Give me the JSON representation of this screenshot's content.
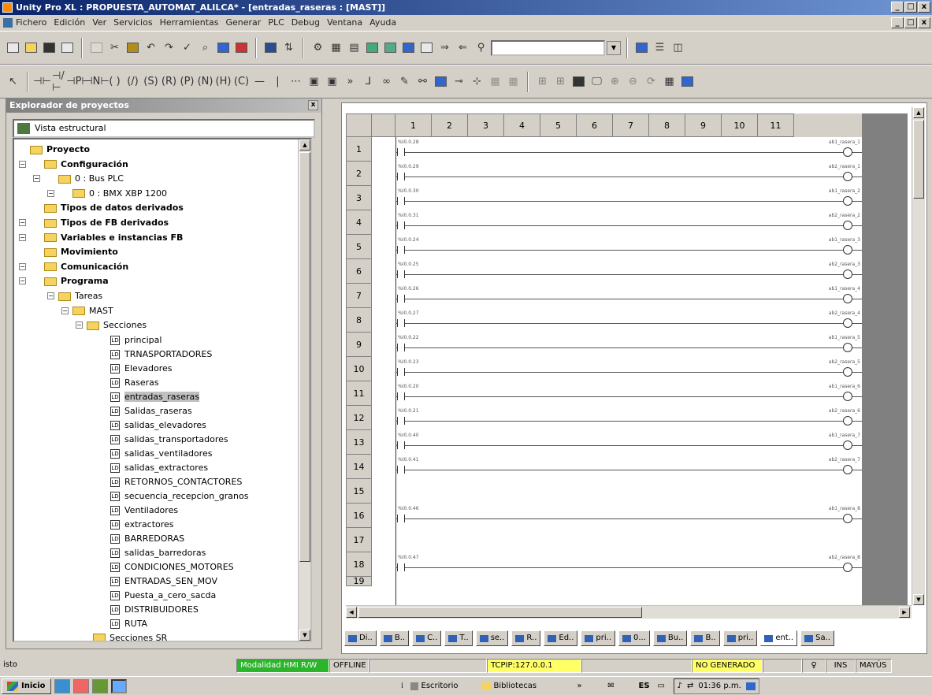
{
  "window": {
    "title": "Unity Pro XL : PROPUESTA_AUTOMAT_ALILCA* - [entradas_raseras : [MAST]]",
    "min": "_",
    "max": "□",
    "close": "x"
  },
  "menu": [
    "Fichero",
    "Edición",
    "Ver",
    "Servicios",
    "Herramientas",
    "Generar",
    "PLC",
    "Debug",
    "Ventana",
    "Ayuda"
  ],
  "explorer": {
    "title": "Explorador de proyectos",
    "view": "Vista estructural",
    "tree": [
      {
        "label": "Proyecto",
        "bold": true
      },
      {
        "label": "Configuración",
        "bold": true
      },
      {
        "label": "0 : Bus PLC",
        "bold": false
      },
      {
        "label": "0 : BMX XBP 1200",
        "bold": false
      },
      {
        "label": "Tipos de datos derivados",
        "bold": true
      },
      {
        "label": "Tipos de FB derivados",
        "bold": true
      },
      {
        "label": "Variables e instancias FB",
        "bold": true
      },
      {
        "label": "Movimiento",
        "bold": true
      },
      {
        "label": "Comunicación",
        "bold": true
      },
      {
        "label": "Programa",
        "bold": true
      },
      {
        "label": "Tareas",
        "bold": false
      },
      {
        "label": "MAST",
        "bold": false
      },
      {
        "label": "Secciones",
        "bold": false
      },
      {
        "label": "principal"
      },
      {
        "label": "TRNASPORTADORES"
      },
      {
        "label": "Elevadores"
      },
      {
        "label": "Raseras"
      },
      {
        "label": "entradas_raseras"
      },
      {
        "label": "Salidas_raseras"
      },
      {
        "label": "salidas_elevadores"
      },
      {
        "label": "salidas_transportadores"
      },
      {
        "label": "salidas_ventiladores"
      },
      {
        "label": "salidas_extractores"
      },
      {
        "label": "RETORNOS_CONTACTORES"
      },
      {
        "label": "secuencia_recepcion_granos"
      },
      {
        "label": "Ventiladores"
      },
      {
        "label": "extractores"
      },
      {
        "label": "BARREDORAS"
      },
      {
        "label": "salidas_barredoras"
      },
      {
        "label": "CONDICIONES_MOTORES"
      },
      {
        "label": "ENTRADAS_SEN_MOV"
      },
      {
        "label": "Puesta_a_cero_sacda"
      },
      {
        "label": "DISTRIBUIDORES"
      },
      {
        "label": "RUTA"
      },
      {
        "label": "Secciones SR"
      }
    ]
  },
  "ladder": {
    "columns": [
      "",
      "",
      "1",
      "2",
      "3",
      "4",
      "5",
      "6",
      "7",
      "8",
      "9",
      "10",
      "11"
    ],
    "rows": [
      "1",
      "2",
      "3",
      "4",
      "5",
      "6",
      "7",
      "8",
      "9",
      "10",
      "11",
      "12",
      "13",
      "14",
      "15",
      "16",
      "17",
      "18",
      "19"
    ],
    "contacts": [
      "%I0.0.28",
      "%I0.0.29",
      "%I0.0.30",
      "%I0.0.31",
      "%I0.0.24",
      "%I0.0.25",
      "%I0.0.26",
      "%I0.0.27",
      "%I0.0.22",
      "%I0.0.23",
      "%I0.0.20",
      "%I0.0.21",
      "%I0.0.40",
      "%I0.0.41",
      "",
      "%I0.0.46",
      "",
      "%I0.0.47",
      ""
    ],
    "coils": [
      "ab1_rasera_1",
      "ab2_rasera_1",
      "ab1_rasera_2",
      "ab2_rasera_2",
      "ab1_rasera_3",
      "ab2_rasera_3",
      "ab1_rasera_4",
      "ab2_rasera_4",
      "ab1_rasera_5",
      "ab2_rasera_5",
      "ab1_rasera_6",
      "ab2_rasera_6",
      "ab1_rasera_7",
      "ab2_rasera_7",
      "",
      "ab1_rasera_8",
      "",
      "ab2_rasera_8",
      ""
    ]
  },
  "tabs": [
    "Di..",
    "B..",
    "C..",
    "T..",
    "se..",
    "R..",
    "Ed..",
    "pri..",
    "0...",
    "Bu..",
    "B..",
    "pri..",
    "ent..",
    "Sa.."
  ],
  "status": {
    "left": "isto",
    "mode": "Modalidad HMI R/W",
    "conn": "OFFLINE",
    "tcpip": "TCPIP:127.0.0.1",
    "gen": "NO GENERADO",
    "ins": "INS",
    "caps": "MAYÚS"
  },
  "taskbar": {
    "start": "Inicio",
    "desk": "Escritorio",
    "bib": "Bibliotecas",
    "lang": "ES",
    "time": "01:36 p.m."
  },
  "colors": {
    "mode": "#2bb52b",
    "tcpip": "#ffff66",
    "gen": "#ffff66"
  }
}
